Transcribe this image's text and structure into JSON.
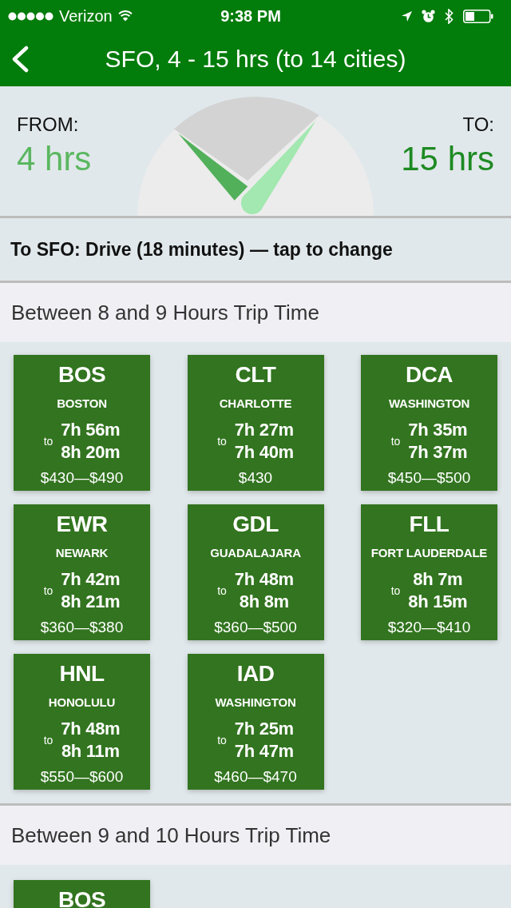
{
  "status_bar": {
    "carrier": "Verizon",
    "time": "9:38 PM"
  },
  "nav": {
    "title": "SFO, 4 - 15 hrs (to 14 cities)"
  },
  "range": {
    "from": {
      "label": "FROM:",
      "value": "4 hrs",
      "level": 0.26
    },
    "to": {
      "label": "TO:",
      "value": "15 hrs",
      "level": 0.68
    }
  },
  "origin_bar": {
    "text": "To SFO: Drive (18 minutes) — tap to change"
  },
  "sections": [
    {
      "title": "Between 8 and 9 Hours Trip Time",
      "cards": [
        {
          "code": "BOS",
          "city": "BOSTON",
          "connector": "to",
          "time_min": "7h 56m",
          "time_max": "8h 20m",
          "price": "$430—$490"
        },
        {
          "code": "CLT",
          "city": "CHARLOTTE",
          "connector": "to",
          "time_min": "7h 27m",
          "time_max": "7h 40m",
          "price": "$430"
        },
        {
          "code": "DCA",
          "city": "WASHINGTON",
          "connector": "to",
          "time_min": "7h 35m",
          "time_max": "7h 37m",
          "price": "$450—$500"
        },
        {
          "code": "EWR",
          "city": "NEWARK",
          "connector": "to",
          "time_min": "7h 42m",
          "time_max": "8h 21m",
          "price": "$360—$380"
        },
        {
          "code": "GDL",
          "city": "GUADALAJARA",
          "connector": "to",
          "time_min": "7h 48m",
          "time_max": "8h 8m",
          "price": "$360—$500"
        },
        {
          "code": "FLL",
          "city": "FORT LAUDERDALE",
          "connector": "to",
          "time_min": "8h 7m",
          "time_max": "8h 15m",
          "price": "$320—$410"
        },
        {
          "code": "HNL",
          "city": "HONOLULU",
          "connector": "to",
          "time_min": "7h 48m",
          "time_max": "8h 11m",
          "price": "$550—$600"
        },
        {
          "code": "IAD",
          "city": "WASHINGTON",
          "connector": "to",
          "time_min": "7h 25m",
          "time_max": "7h 47m",
          "price": "$460—$470"
        }
      ]
    },
    {
      "title": "Between 9 and 10 Hours Trip Time",
      "cards": [
        {
          "code": "BOS"
        }
      ]
    }
  ]
}
